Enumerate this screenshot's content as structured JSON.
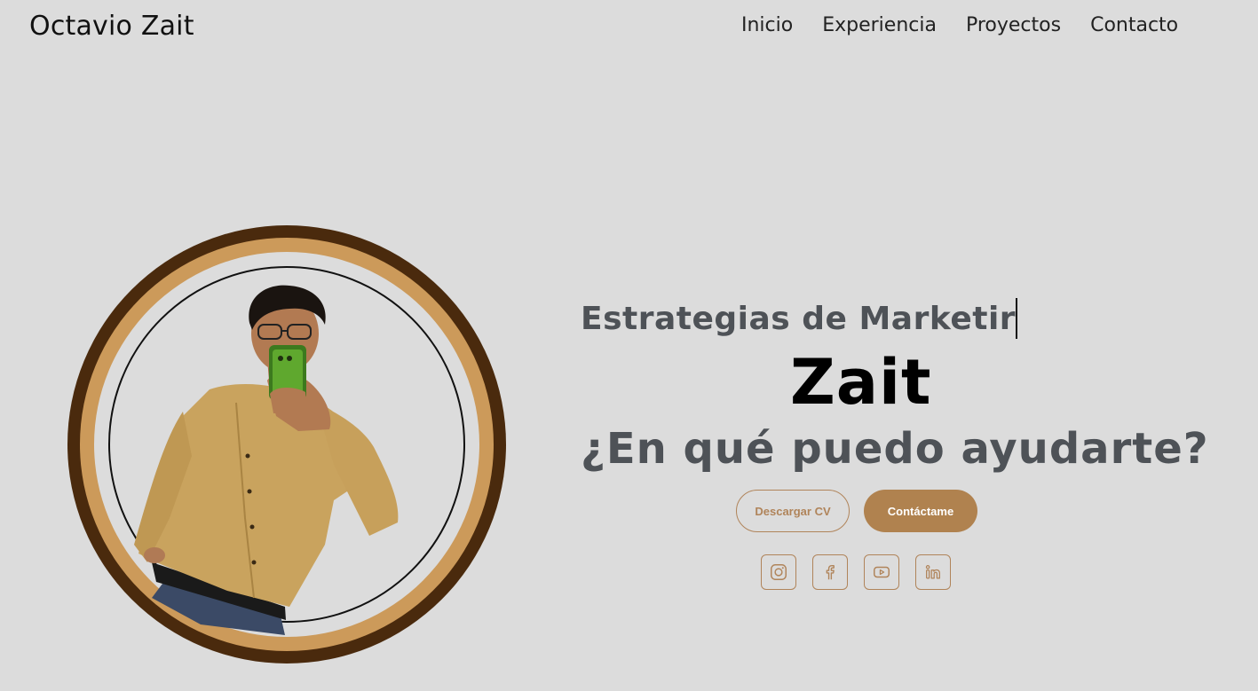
{
  "brand": {
    "name": "Octavio Zait"
  },
  "nav": {
    "items": [
      {
        "label": "Inicio"
      },
      {
        "label": "Experiencia"
      },
      {
        "label": "Proyectos"
      },
      {
        "label": "Contacto"
      }
    ]
  },
  "hero": {
    "typed_text": "Estrategias de Marketir",
    "name": "Zait",
    "question": "¿En qué puedo ayudarte?",
    "buttons": {
      "download_cv": "Descargar CV",
      "contact": "Contáctame"
    },
    "social_icons": [
      "instagram-icon",
      "facebook-icon",
      "youtube-icon",
      "linkedin-icon"
    ]
  },
  "colors": {
    "background": "#dcdcdc",
    "accent": "#b0824f",
    "ring_outer": "#4a2a0d",
    "ring_mid": "#cc9a5a",
    "heading_gray": "#4e5257"
  }
}
